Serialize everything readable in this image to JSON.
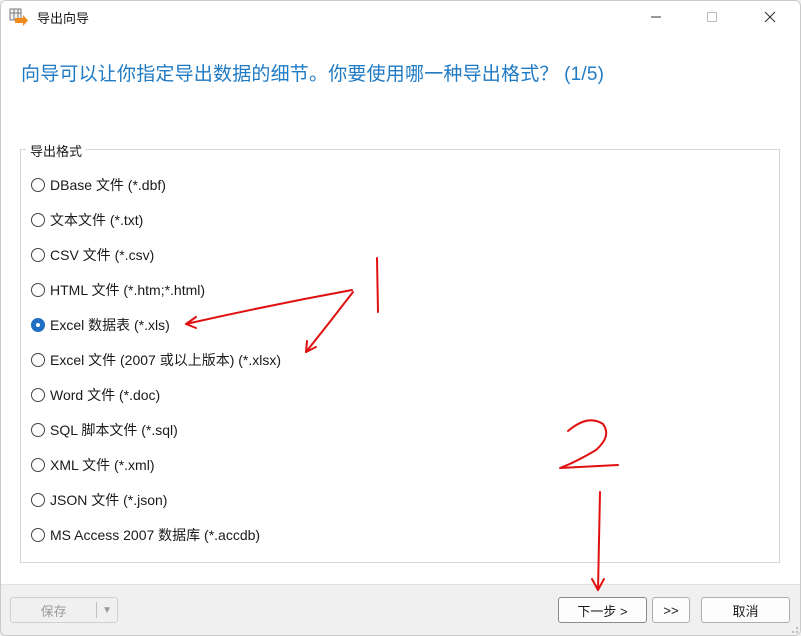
{
  "window": {
    "title": "导出向导",
    "minimize_icon": "minimize-icon",
    "maximize_icon": "maximize-icon",
    "close_icon": "close-icon"
  },
  "heading": "向导可以让你指定导出数据的细节。你要使用哪一种导出格式？ (1/5)",
  "export_format": {
    "legend": "导出格式",
    "selected": "Excel 数据表 (*.xls)",
    "options": [
      "DBase 文件 (*.dbf)",
      "文本文件 (*.txt)",
      "CSV 文件 (*.csv)",
      "HTML 文件 (*.htm;*.html)",
      "Excel 数据表 (*.xls)",
      "Excel 文件 (2007 或以上版本) (*.xlsx)",
      "Word 文件 (*.doc)",
      "SQL 脚本文件 (*.sql)",
      "XML 文件 (*.xml)",
      "JSON 文件 (*.json)",
      "MS Access 2007 数据库 (*.accdb)"
    ]
  },
  "footer": {
    "save_label": "保存",
    "next_label": "下一步 >",
    "last_label": ">>",
    "cancel_label": "取消"
  },
  "colors": {
    "accent": "#1f7ac4",
    "annotation": "#e01010"
  }
}
